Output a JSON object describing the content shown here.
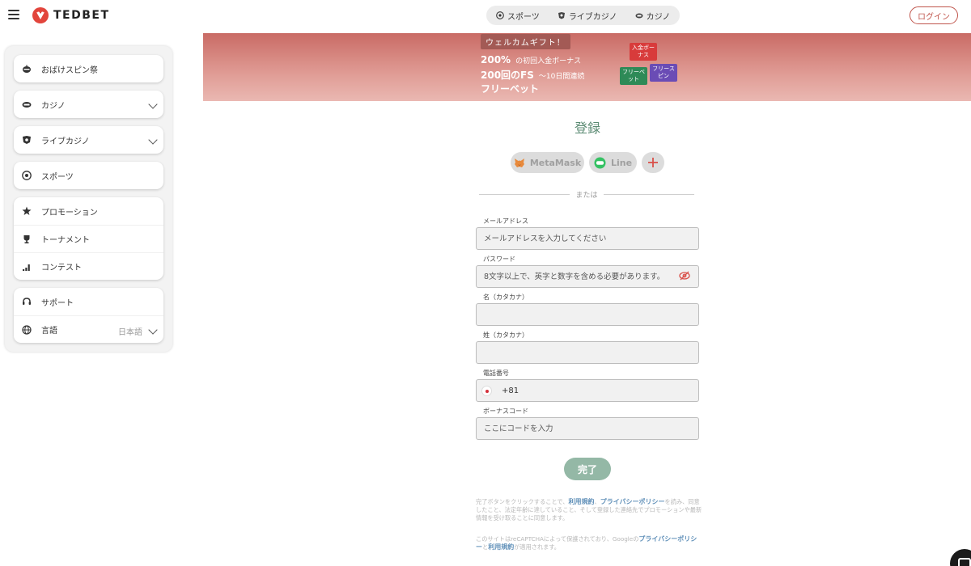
{
  "header": {
    "logo_text": "TEDBET",
    "nav": [
      {
        "label": "スポーツ",
        "icon": "soccer-ball-icon"
      },
      {
        "label": "ライブカジノ",
        "icon": "joker-icon"
      },
      {
        "label": "カジノ",
        "icon": "slot-icon"
      }
    ],
    "login_label": "ログイン"
  },
  "sidebar": {
    "spin_festival": "おばけスピン祭",
    "casino": "カジノ",
    "live_casino": "ライブカジノ",
    "sports": "スポーツ",
    "promotion": "プロモーション",
    "tournament": "トーナメント",
    "contest": "コンテスト",
    "support": "サポート",
    "language": "言語",
    "language_value": "日本語"
  },
  "banner": {
    "tag": "ウェルカムギフト！",
    "line1_strong": "200%",
    "line1_small": "の初回入金ボーナス",
    "line2_strong": "200回のFS",
    "line2_small": "〜10日間連続",
    "line3_strong": "フリーベット",
    "badge_deposit": "入金ボーナス",
    "badge_freebet": "フリーベット",
    "badge_freespin": "フリースピン"
  },
  "register": {
    "title": "登録",
    "metamask_label": "MetaMask",
    "line_label": "Line",
    "or_label": "または",
    "email_label": "メールアドレス",
    "email_placeholder": "メールアドレスを入力してください",
    "password_label": "パスワード",
    "password_placeholder": "8文字以上で、英字と数字を含める必要があります。",
    "first_name_label": "名（カタカナ）",
    "last_name_label": "姓（カタカナ）",
    "phone_label": "電話番号",
    "phone_code": "+81",
    "bonus_label": "ボーナスコード",
    "bonus_placeholder": "ここにコードを入力",
    "submit_label": "完了"
  },
  "legal": {
    "p1_a": "完了ボタンをクリックすることで、",
    "p1_terms": "利用規約",
    "p1_b": "、",
    "p1_privacy": "プライバシーポリシー",
    "p1_c": "を読み、同意したこと、法定年齢に達していること、そして登録した連絡先でプロモーションや最新情報を受け取ることに同意します。",
    "p2_a": "このサイトはreCAPTCHAによって保護されており、Googleの",
    "p2_privacy": "プライバシーポリシー",
    "p2_b": "と",
    "p2_terms": "利用規約",
    "p2_c": "が適用されます。"
  },
  "colors": {
    "accent": "#c0564d",
    "brand_red": "#e2453c",
    "title_green": "#5a8a72",
    "submit_green": "#94b8a6",
    "link_blue": "#5f8fb8"
  }
}
